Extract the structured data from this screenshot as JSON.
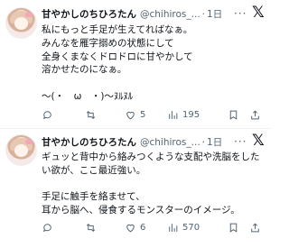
{
  "tweets": [
    {
      "name": "甘やかしのちひろたん",
      "handle": "@chihiros_...",
      "dot": "·",
      "time": "1日",
      "body": "私にもっと手足が生えてればなぁ。\nみんなを雁字搦めの状態にして\n全身くまなくドロドロに甘やかして\n溶かせたのになぁ。\n\n〜(・　ω　・)〜ﾇﾙﾇﾙ",
      "reply_count": "",
      "retweet_count": "",
      "like_count": "5",
      "views_count": "195"
    },
    {
      "name": "甘やかしのちひろたん",
      "handle": "@chihiros_...",
      "dot": "·",
      "time": "1日",
      "body": "ギュッと背中から絡みつくような支配や洗脳をしたい欲が、ここ最近強い。\n\n手足に触手を絡ませて、\n耳から脳へ、侵食するモンスターのイメージ。",
      "reply_count": "",
      "retweet_count": "",
      "like_count": "6",
      "views_count": "570"
    }
  ],
  "icons": {
    "more": "more-icon",
    "x_logo": "x-logo-icon",
    "reply": "reply-icon",
    "retweet": "retweet-icon",
    "like": "heart-icon",
    "views": "views-icon",
    "bookmark": "bookmark-icon",
    "share": "share-icon"
  },
  "colors": {
    "text": "#0f1419",
    "secondary": "#536471",
    "divider": "#eff3f4"
  }
}
